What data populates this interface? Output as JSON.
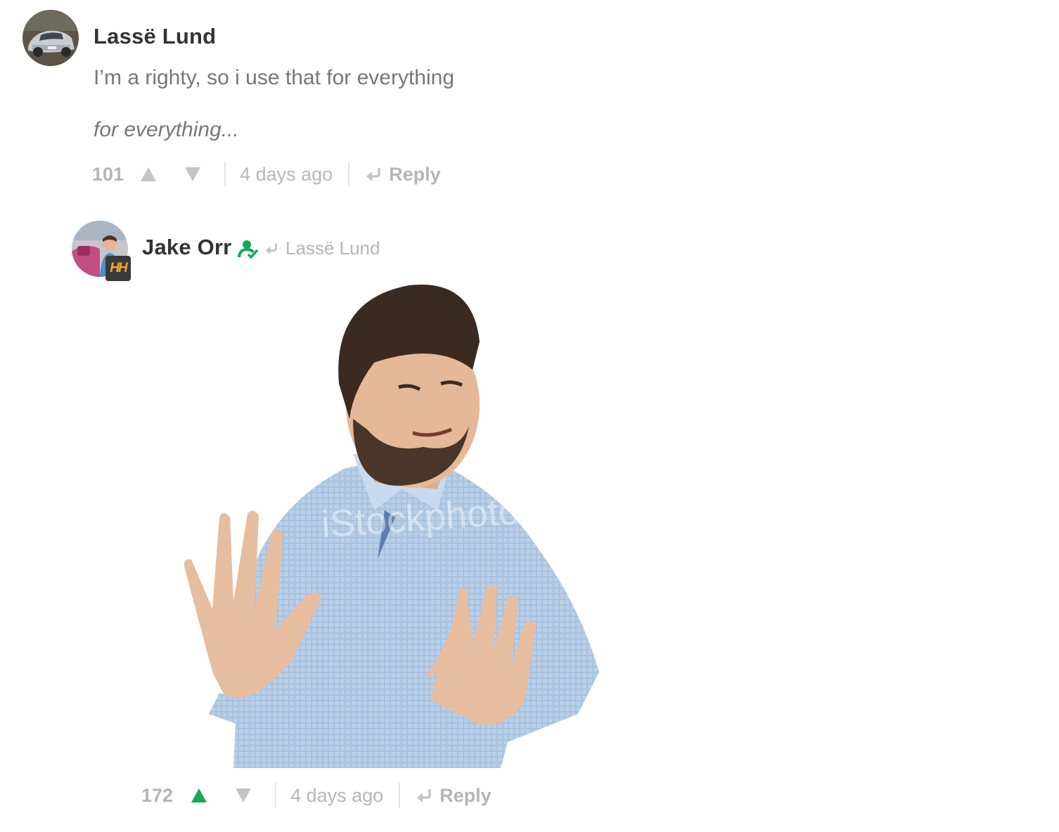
{
  "comments": [
    {
      "author": "Lassë Lund",
      "body_lines": [
        "I’m a righty, so i use that for everything"
      ],
      "italic_line": "for everything...",
      "votes": "101",
      "time": "4 days ago",
      "reply_label": "Reply"
    },
    {
      "author": "Jake Orr",
      "reply_to": "Lassë Lund",
      "badge_text": "HH",
      "image_watermark": "iStockphoto",
      "votes": "172",
      "time": "4 days ago",
      "reply_label": "Reply",
      "upvoted": true
    }
  ],
  "colors": {
    "accent_green": "#14a85a",
    "muted": "#b6b6b6",
    "badge_bg": "#3a3a3a",
    "badge_fg": "#f5a623"
  },
  "icons": [
    "upvote-icon",
    "downvote-icon",
    "reply-arrow-icon",
    "verified-user-icon",
    "badge-hh-icon"
  ]
}
